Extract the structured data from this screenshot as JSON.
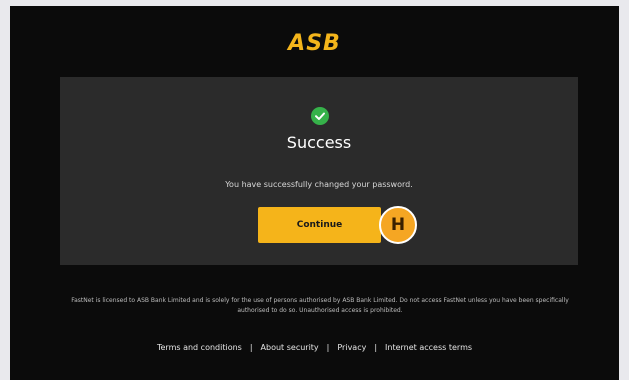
{
  "header": {
    "logo_text": "ASB"
  },
  "card": {
    "status_icon": "check-circle-icon",
    "title": "Success",
    "message": "You have successfully changed your password.",
    "continue_label": "Continue",
    "annotation_badge": "H"
  },
  "footer": {
    "disclaimer": "FastNet is licensed to ASB Bank Limited and is solely for the use of persons authorised by ASB Bank Limited. Do not access FastNet unless you have been specifically authorised to do so. Unauthorised access is prohibited.",
    "links": [
      "Terms and conditions",
      "About security",
      "Privacy",
      "Internet access terms"
    ],
    "separator": "|"
  },
  "colors": {
    "brand_yellow": "#f5b41a",
    "background": "#0b0b0b",
    "card": "#2b2b2b",
    "success_green": "#36b24a",
    "badge_orange": "#f5a623"
  }
}
